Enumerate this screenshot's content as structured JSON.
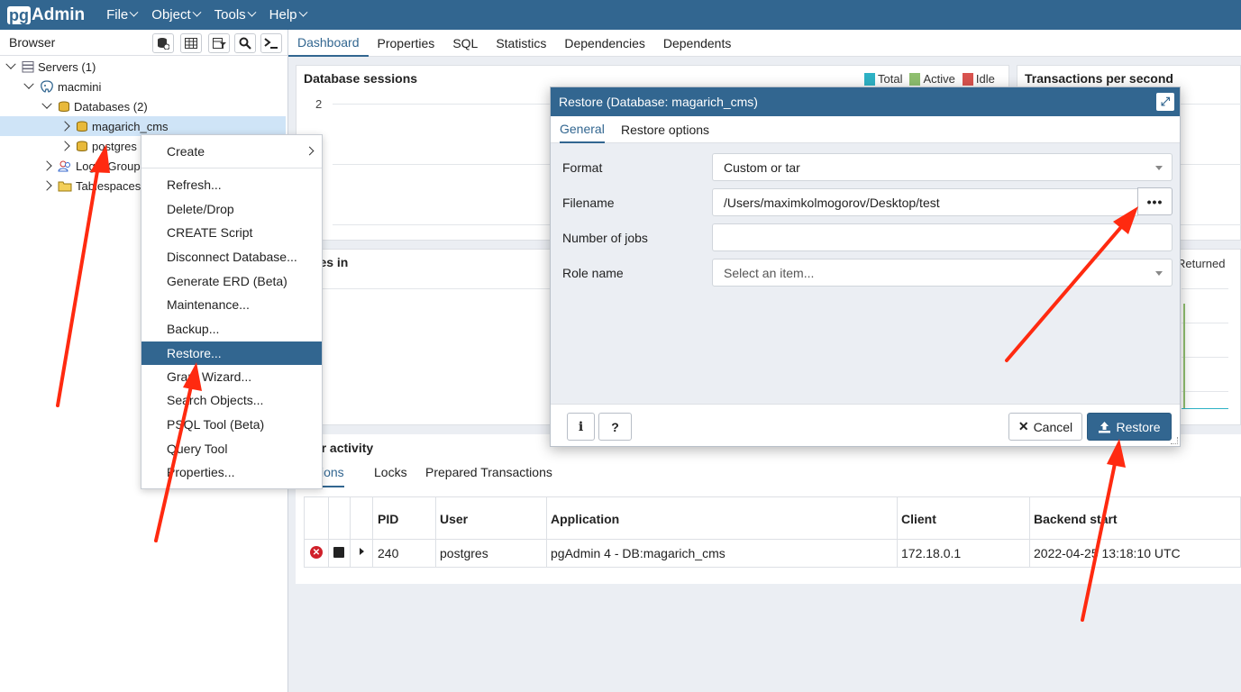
{
  "navbar": {
    "logo_pg": "pg",
    "logo_rest": "Admin",
    "menus": [
      "File",
      "Object",
      "Tools",
      "Help"
    ]
  },
  "browser": {
    "title": "Browser",
    "tree": {
      "servers": "Servers (1)",
      "server": "macmini",
      "databases": "Databases (2)",
      "db1": "magarich_cms",
      "db2": "postgres",
      "login_group": "Login/Group",
      "tablespaces": "Tablespaces"
    }
  },
  "context_menu": {
    "items": [
      "Create",
      "Refresh...",
      "Delete/Drop",
      "CREATE Script",
      "Disconnect Database...",
      "Generate ERD (Beta)",
      "Maintenance...",
      "Backup...",
      "Restore...",
      "Grant Wizard...",
      "Search Objects...",
      "PSQL Tool (Beta)",
      "Query Tool",
      "Properties..."
    ],
    "active_item": "Restore..."
  },
  "main_tabs": [
    "Dashboard",
    "Properties",
    "SQL",
    "Statistics",
    "Dependencies",
    "Dependents"
  ],
  "dashboard": {
    "db_sessions": {
      "title": "Database sessions",
      "legend": [
        "Total",
        "Active",
        "Idle"
      ],
      "y_tick": "2"
    },
    "tps": {
      "title": "Transactions per second"
    },
    "tuples_in": {
      "title": "ples in"
    },
    "tuples_out": {
      "legend": "Returned"
    },
    "server_activity": {
      "title": "ver activity",
      "tabs": [
        "ssions",
        "Locks",
        "Prepared Transactions"
      ],
      "columns": [
        "PID",
        "User",
        "Application",
        "Client",
        "Backend start"
      ],
      "rows": [
        {
          "pid": "240",
          "user": "postgres",
          "application": "pgAdmin 4 - DB:magarich_cms",
          "client": "172.18.0.1",
          "backend_start": "2022-04-25 13:18:10 UTC"
        }
      ]
    }
  },
  "dialog": {
    "title": "Restore (Database: magarich_cms)",
    "tabs": [
      "General",
      "Restore options"
    ],
    "fields": {
      "format_label": "Format",
      "format_value": "Custom or tar",
      "filename_label": "Filename",
      "filename_value": "/Users/maximkolmogorov/Desktop/test",
      "jobs_label": "Number of jobs",
      "jobs_value": "",
      "role_label": "Role name",
      "role_placeholder": "Select an item..."
    },
    "buttons": {
      "info": "i",
      "help": "?",
      "cancel": "Cancel",
      "restore": "Restore",
      "browse": "•••"
    }
  },
  "colors": {
    "brand": "#326690",
    "legend_total": "#2eb2c5",
    "legend_active": "#8fbf6f",
    "legend_idle": "#d9534f",
    "annotation_arrow": "#ff2a10"
  }
}
